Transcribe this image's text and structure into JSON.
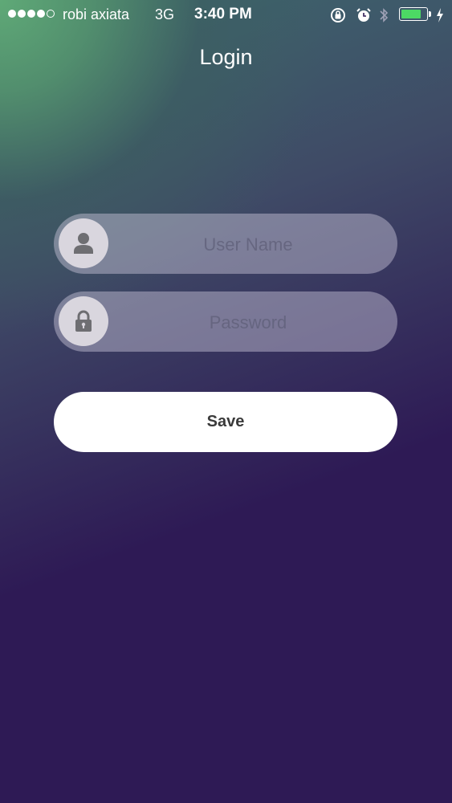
{
  "status_bar": {
    "carrier": "robi axiata",
    "network": "3G",
    "time": "3:40 PM",
    "signal_bars_filled": 4,
    "signal_bars_total": 5,
    "battery_level": 0.8
  },
  "header": {
    "title": "Login"
  },
  "form": {
    "username": {
      "placeholder": "User Name",
      "value": ""
    },
    "password": {
      "placeholder": "Password",
      "value": ""
    },
    "save_label": "Save"
  },
  "colors": {
    "background": "#2e1a55",
    "accent_green": "#5fa977",
    "battery": "#4cd964",
    "button": "#ffffff"
  }
}
